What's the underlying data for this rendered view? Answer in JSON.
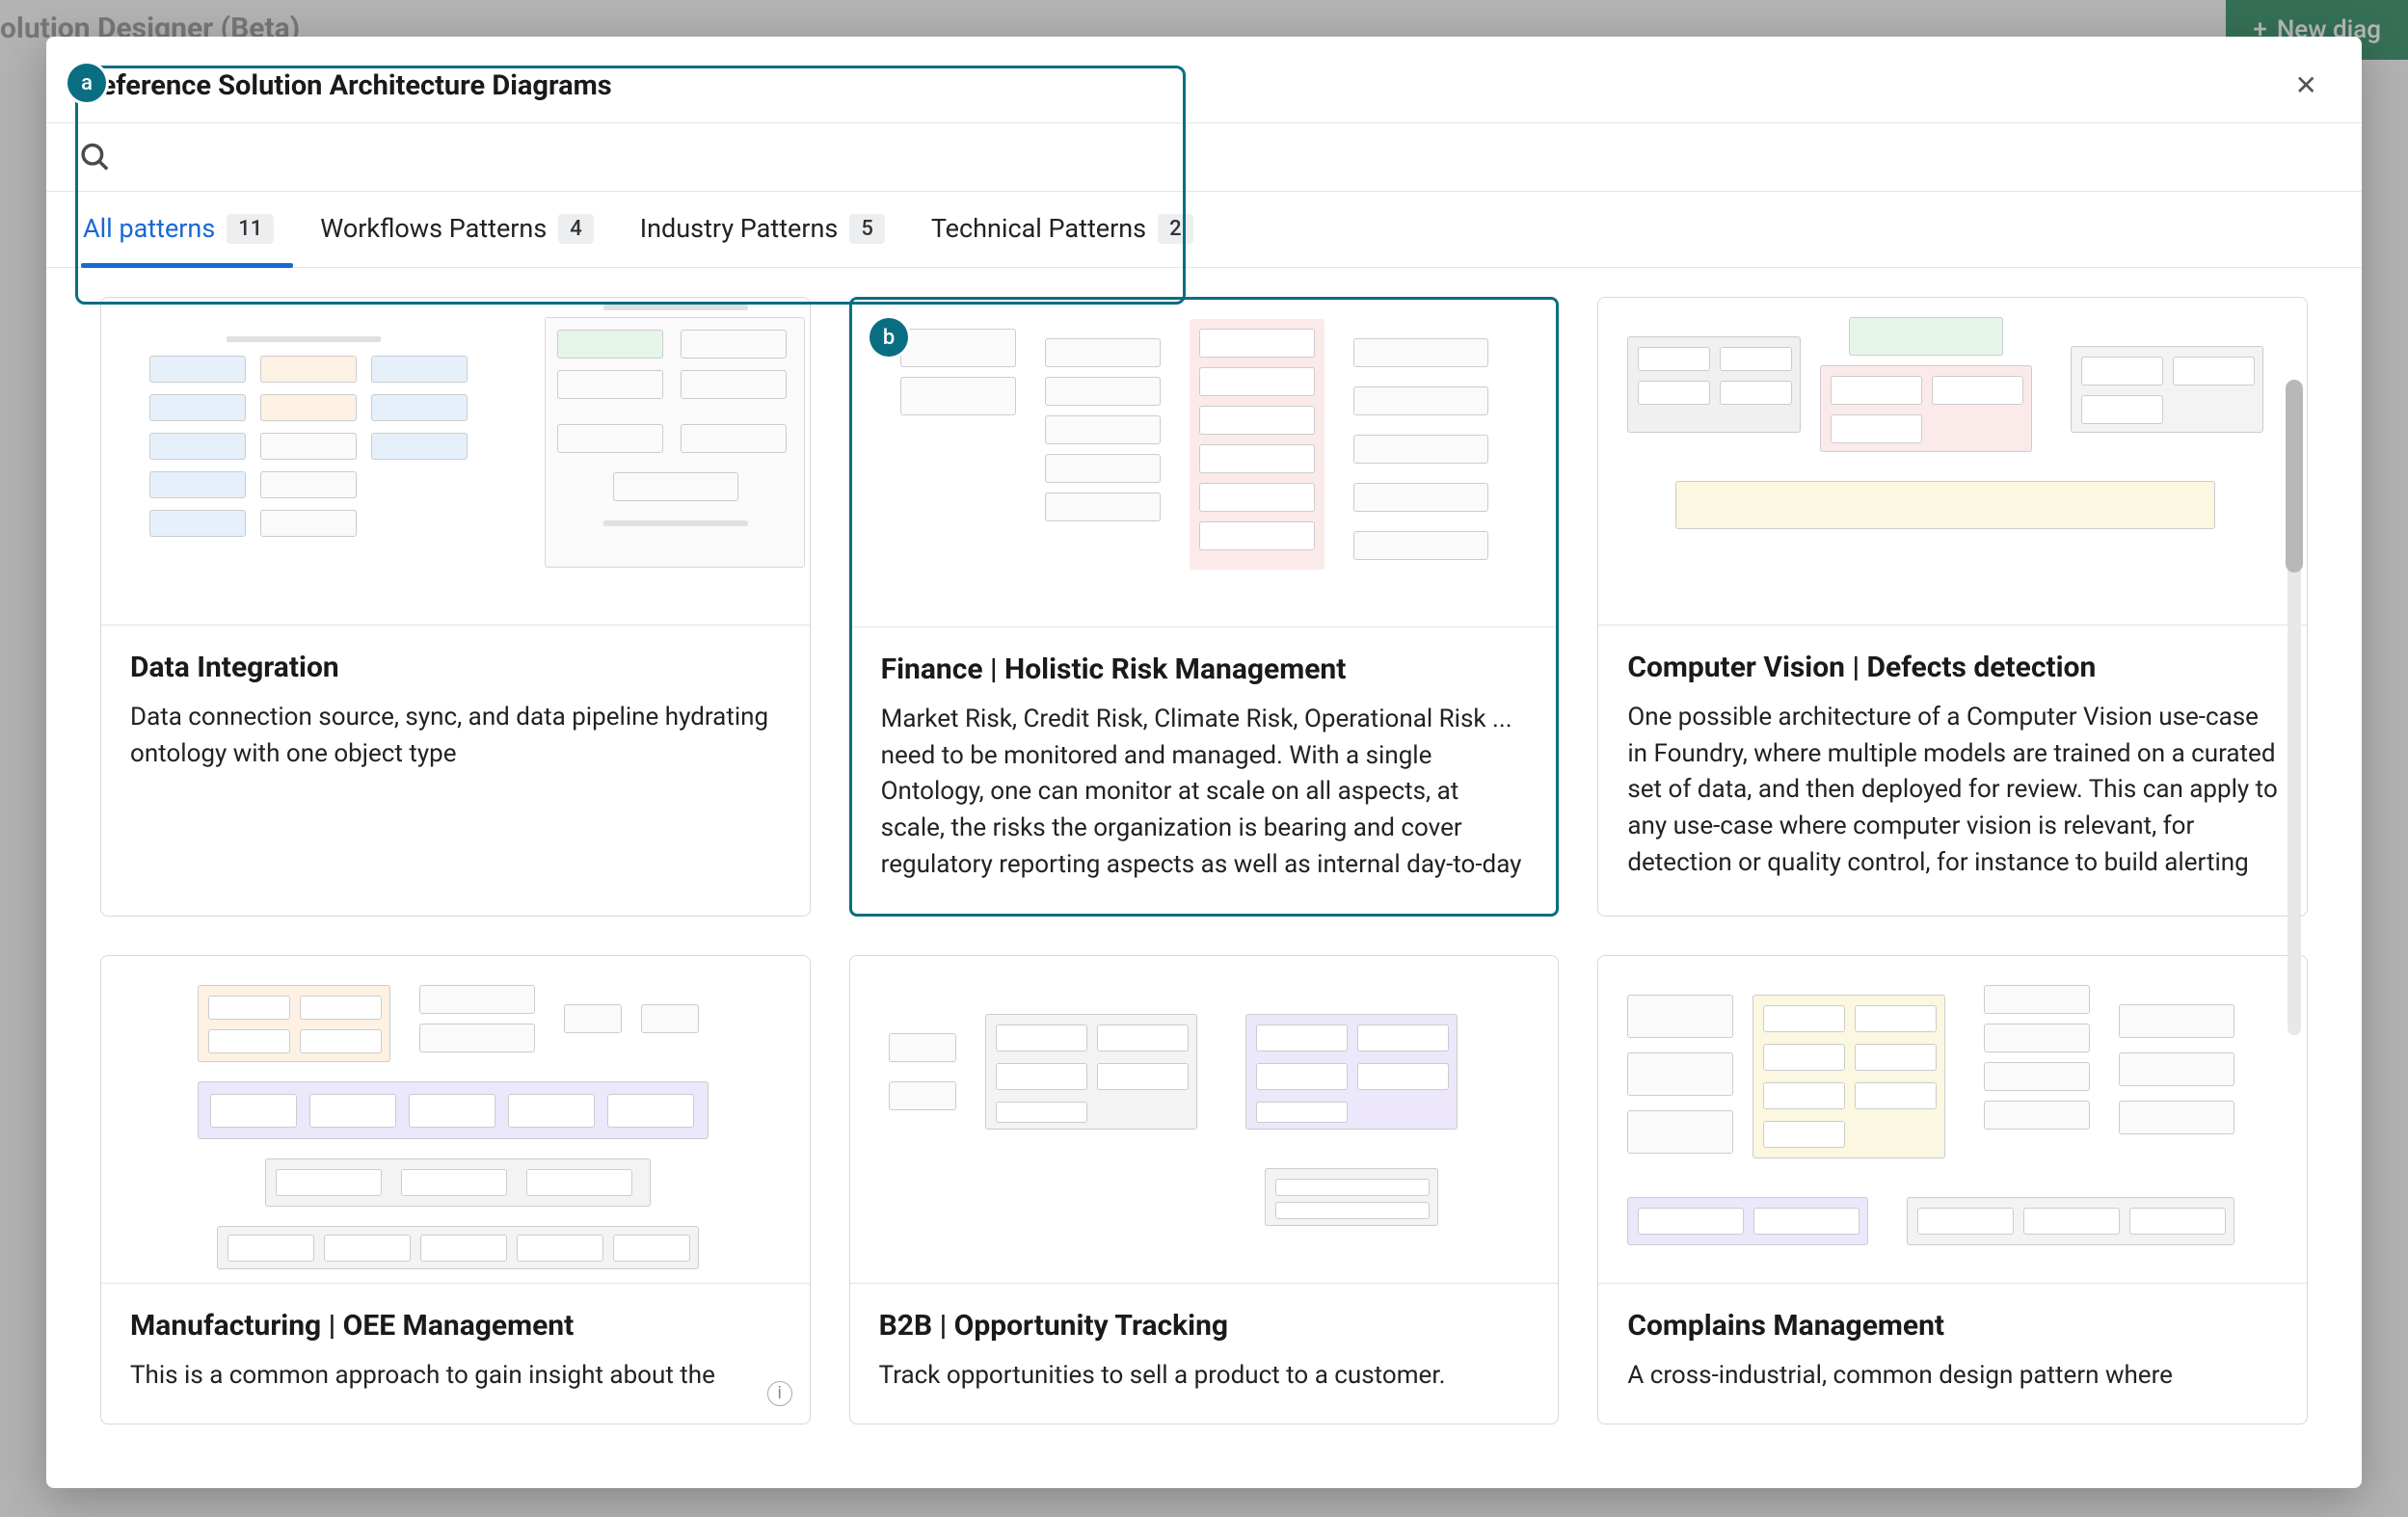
{
  "background": {
    "app_title": "olution Designer (Beta)",
    "new_button_label": "New diag"
  },
  "dialog": {
    "title": "Reference Solution Architecture Diagrams",
    "search_placeholder": "",
    "tabs": [
      {
        "label": "All patterns",
        "count": "11",
        "active": true
      },
      {
        "label": "Workflows Patterns",
        "count": "4",
        "active": false
      },
      {
        "label": "Industry Patterns",
        "count": "5",
        "active": false
      },
      {
        "label": "Technical Patterns",
        "count": "2",
        "active": false
      }
    ],
    "cards": [
      {
        "title": "Data Integration",
        "desc": "Data connection source, sync, and data pipeline hydrating ontology with one object type",
        "highlight": false
      },
      {
        "title": "Finance | Holistic Risk Management",
        "desc": "Market Risk, Credit Risk, Climate Risk, Operational Risk ... need to be monitored and managed. With a single Ontology, one can monitor at scale on all aspects, at scale, the risks the organization is bearing and cover regulatory reporting aspects as well as internal day-to-day reviews.",
        "highlight": true
      },
      {
        "title": "Computer Vision | Defects detection",
        "desc": "One possible architecture of a Computer Vision use-case in Foundry, where multiple models are trained on a curated set of data, and then deployed for review. This can apply to any use-case where computer vision is relevant, for detection or quality control, for instance to build alerting workflows.",
        "highlight": false
      },
      {
        "title": "Manufacturing | OEE Management",
        "desc": "This is a common approach to gain insight about the",
        "highlight": false
      },
      {
        "title": "B2B | Opportunity Tracking",
        "desc": "Track opportunities to sell a product to a customer.",
        "highlight": false
      },
      {
        "title": "Complains Management",
        "desc": "A cross-industrial, common design pattern where",
        "highlight": false
      }
    ]
  },
  "callouts": {
    "a": "a",
    "b": "b"
  }
}
